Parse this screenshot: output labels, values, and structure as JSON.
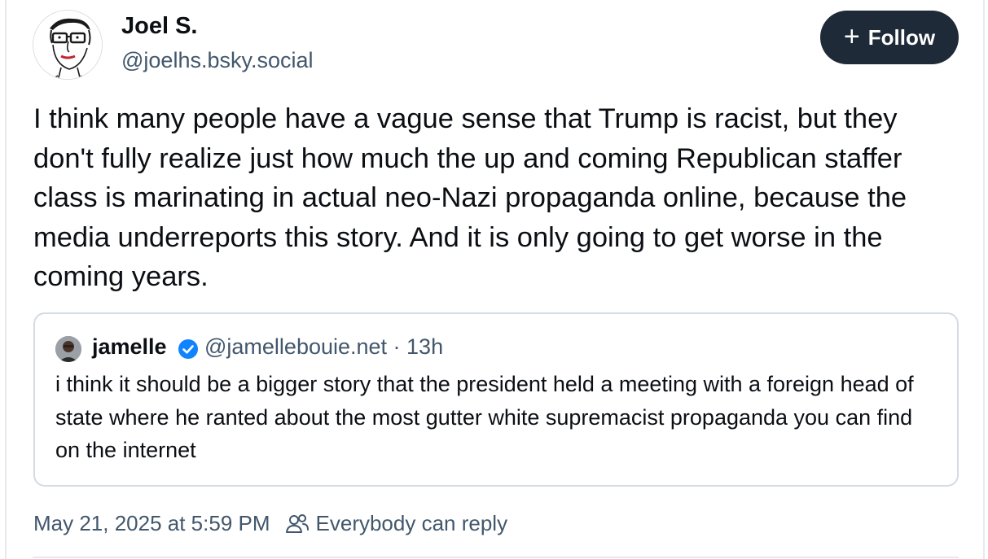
{
  "author": {
    "name": "Joel S.",
    "handle": "@joelhs.bsky.social",
    "avatar_icon": "sketch-face-avatar"
  },
  "follow_button": {
    "label": "Follow",
    "icon": "plus-icon",
    "bg_color": "#1e2a37"
  },
  "post": {
    "text": "I think many people have a vague sense that Trump is racist, but they don't fully realize just how much the up and coming Republican staffer class is marinating in actual neo-Nazi propaganda online, because the media underreports this story. And it is only going to get worse in the coming years."
  },
  "quoted_post": {
    "author_name": "jamelle",
    "verified": true,
    "verified_icon": "verified-check-icon",
    "verified_color": "#1083fe",
    "handle_and_time": "@jamellebouie.net · 13h",
    "text": "i think it should be a bigger story that the president held a meeting with a foreign head of state where he ranted about the most gutter white supremacist propaganda you can find on the internet"
  },
  "footer": {
    "timestamp": "May 21, 2025 at 5:59 PM",
    "reply_setting_icon": "people-icon",
    "reply_setting": "Everybody can reply"
  },
  "colors": {
    "text_primary": "#0b0f14",
    "text_secondary": "#42576c",
    "border": "#d4dbe2"
  }
}
